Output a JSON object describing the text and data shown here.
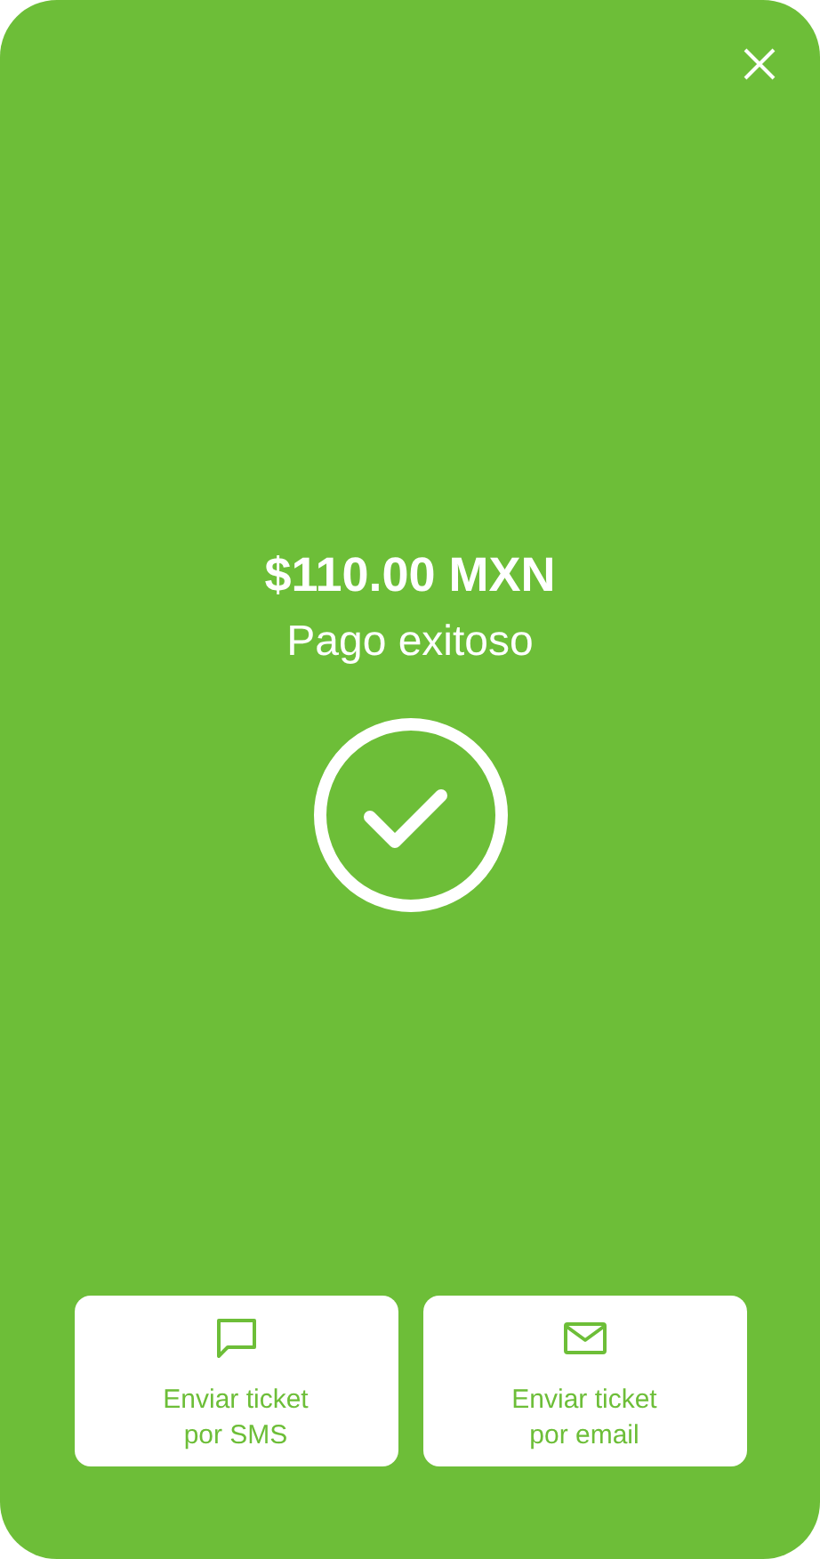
{
  "amount": "$110.00 MXN",
  "status": "Pago exitoso",
  "actions": [
    {
      "kind": "sms",
      "lines": [
        "Enviar ticket",
        "por SMS"
      ]
    },
    {
      "kind": "email",
      "lines": [
        "Enviar ticket",
        "por email"
      ]
    }
  ]
}
